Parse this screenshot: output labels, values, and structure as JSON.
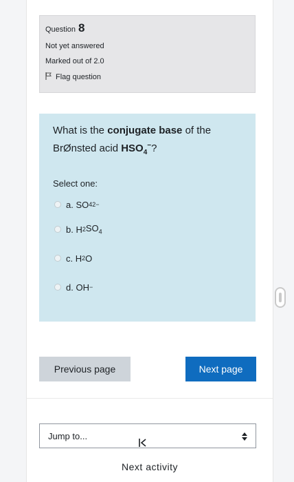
{
  "question": {
    "label": "Question",
    "number": "8",
    "status": "Not yet answered",
    "marks": "Marked out of 2.0",
    "flag_label": "Flag question",
    "text_part1": "What is the ",
    "text_bold": "conjugate base",
    "text_part2": " of the BrØnsted acid ",
    "formula": "HSO4",
    "formula_main": "HSO",
    "formula_sub": "4",
    "formula_sup": "−",
    "text_end": "?",
    "select_label": "Select one:",
    "options": [
      {
        "letter": "a.",
        "main": "SO",
        "sub": "4",
        "sup": "2−",
        "tail": ""
      },
      {
        "letter": "b.",
        "main": "H",
        "sub": "2",
        "sup": "",
        "tail": "SO4"
      },
      {
        "letter": "c.",
        "main": "H",
        "sub": "2",
        "sup": "",
        "tail": "O"
      },
      {
        "letter": "d.",
        "main": "OH",
        "sub": "",
        "sup": "−",
        "tail": ""
      }
    ]
  },
  "nav": {
    "previous_label": "Previous page",
    "next_label": "Next page",
    "jump_label": "Jump to...",
    "next_activity_label": "Next activity"
  },
  "icons": {
    "flag": "flag-icon",
    "previous_activity": "previous-activity-icon",
    "select_arrows": "select-arrows-icon",
    "scroll": "scroll-handle-icon"
  },
  "colors": {
    "info_bg": "#e6e6e8",
    "question_bg": "#cfe7ef",
    "primary_button": "#0f6cbf",
    "secondary_button": "#ced4da"
  }
}
